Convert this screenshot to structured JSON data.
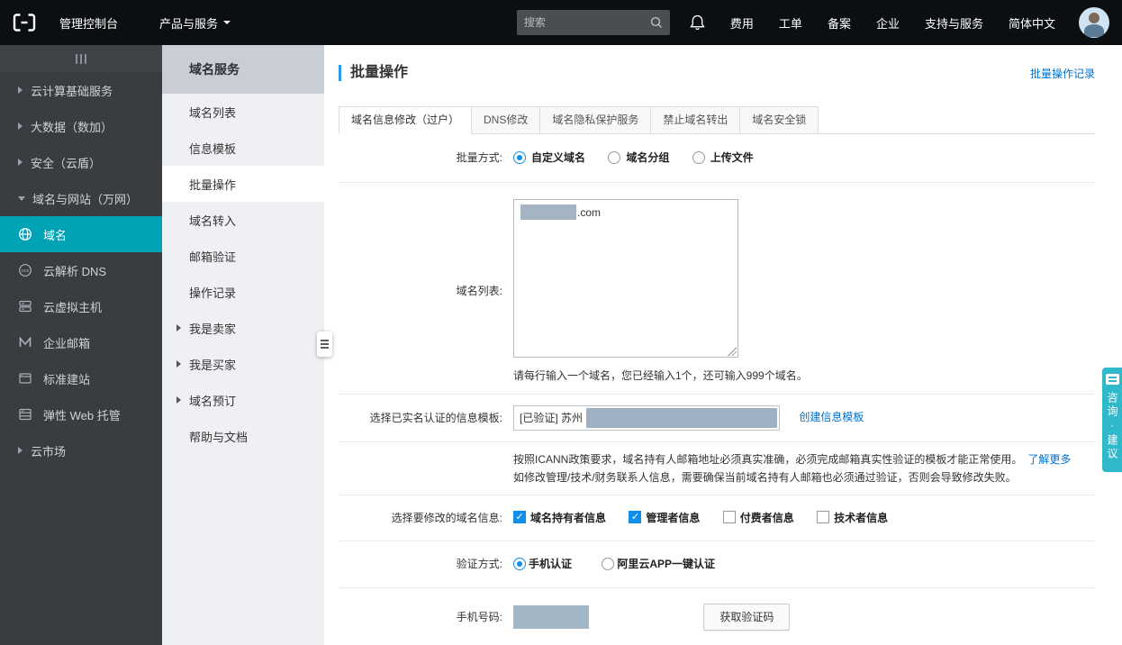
{
  "topbar": {
    "console_label": "管理控制台",
    "products_label": "产品与服务",
    "search_placeholder": "搜索",
    "links": [
      "费用",
      "工单",
      "备案",
      "企业",
      "支持与服务",
      "简体中文"
    ]
  },
  "sidebar": {
    "items": [
      {
        "label": "云计算基础服务",
        "expandable": true
      },
      {
        "label": "大数据（数加）",
        "expandable": true
      },
      {
        "label": "安全（云盾）",
        "expandable": true
      },
      {
        "label": "域名与网站（万网）",
        "expanded": true
      },
      {
        "label": "域名",
        "icon": "globe-icon",
        "active": true
      },
      {
        "label": "云解析 DNS",
        "icon": "dns-icon"
      },
      {
        "label": "云虚拟主机",
        "icon": "server-icon"
      },
      {
        "label": "企业邮箱",
        "icon": "mail-m-icon"
      },
      {
        "label": "标准建站",
        "icon": "browser-icon"
      },
      {
        "label": "弹性 Web 托管",
        "icon": "hosting-icon"
      },
      {
        "label": "云市场",
        "expandable": true
      }
    ]
  },
  "submenu": {
    "title": "域名服务",
    "items": [
      {
        "label": "域名列表"
      },
      {
        "label": "信息模板"
      },
      {
        "label": "批量操作",
        "active": true
      },
      {
        "label": "域名转入"
      },
      {
        "label": "邮箱验证"
      },
      {
        "label": "操作记录"
      },
      {
        "label": "我是卖家",
        "expandable": true
      },
      {
        "label": "我是买家",
        "expandable": true
      },
      {
        "label": "域名预订",
        "expandable": true
      },
      {
        "label": "帮助与文档"
      }
    ]
  },
  "main": {
    "title": "批量操作",
    "history_link": "批量操作记录",
    "tabs": [
      {
        "label": "域名信息修改（过户）",
        "active": true
      },
      {
        "label": "DNS修改"
      },
      {
        "label": "域名隐私保护服务"
      },
      {
        "label": "禁止域名转出"
      },
      {
        "label": "域名安全锁"
      }
    ],
    "form": {
      "batch_mode_label": "批量方式:",
      "batch_modes": [
        {
          "label": "自定义域名",
          "checked": true
        },
        {
          "label": "域名分组",
          "checked": false
        },
        {
          "label": "上传文件",
          "checked": false
        }
      ],
      "domain_list_label": "域名列表:",
      "domain_suffix": ".com",
      "domain_help": "请每行输入一个域名，您已经输入1个，还可输入999个域名。",
      "template_label": "选择已实名认证的信息模板:",
      "template_value_prefix": "[已验证] 苏州",
      "create_template_link": "创建信息模板",
      "notice_line1": "按照ICANN政策要求，域名持有人邮箱地址必须真实准确，必须完成邮箱真实性验证的模板才能正常使用。",
      "notice_link": "了解更多",
      "notice_line2": "如修改管理/技术/财务联系人信息，需要确保当前域名持有人邮箱也必须通过验证，否则会导致修改失败。",
      "modify_label": "选择要修改的域名信息:",
      "modify_options": [
        {
          "label": "域名持有者信息",
          "checked": true
        },
        {
          "label": "管理者信息",
          "checked": true
        },
        {
          "label": "付费者信息",
          "checked": false
        },
        {
          "label": "技术者信息",
          "checked": false
        }
      ],
      "verify_label": "验证方式:",
      "verify_options": [
        {
          "label": "手机认证",
          "checked": true
        },
        {
          "label": "阿里云APP一键认证",
          "checked": false
        }
      ],
      "phone_label": "手机号码:",
      "get_code_button": "获取验证码"
    }
  },
  "feedback": {
    "label": "咨询·建议"
  },
  "colors": {
    "sidebar_active_teal": "#00a3b5",
    "link_blue": "#0070cc",
    "control_blue": "#108ee9",
    "feedback_cyan": "#2fb9cb",
    "title_accent_blue": "#2a9ae5"
  }
}
